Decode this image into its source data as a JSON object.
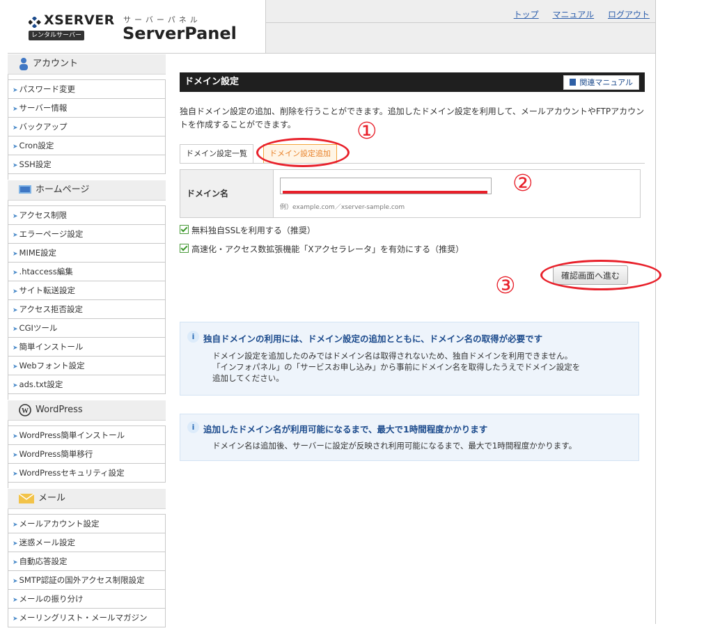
{
  "header": {
    "brand": "XSERVER",
    "badge": "レンタルサーバー",
    "panel_sub": "サーバーパネル",
    "panel_title": "ServerPanel",
    "links": [
      "トップ",
      "マニュアル",
      "ログアウト"
    ]
  },
  "sidebar": {
    "sections": [
      {
        "title": "アカウント",
        "icon": "person-icon",
        "items": [
          "パスワード変更",
          "サーバー情報",
          "バックアップ",
          "Cron設定",
          "SSH設定"
        ]
      },
      {
        "title": "ホームページ",
        "icon": "monitor-icon",
        "items": [
          "アクセス制限",
          "エラーページ設定",
          "MIME設定",
          ".htaccess編集",
          "サイト転送設定",
          "アクセス拒否設定",
          "CGIツール",
          "簡単インストール",
          "Webフォント設定",
          "ads.txt設定"
        ]
      },
      {
        "title": "WordPress",
        "icon": "wordpress-icon",
        "items": [
          "WordPress簡単インストール",
          "WordPress簡単移行",
          "WordPressセキュリティ設定"
        ]
      },
      {
        "title": "メール",
        "icon": "envelope-icon",
        "items": [
          "メールアカウント設定",
          "迷惑メール設定",
          "自動応答設定",
          "SMTP認証の国外アクセス制限設定",
          "メールの振り分け",
          "メーリングリスト・メールマガジン"
        ]
      }
    ]
  },
  "main": {
    "title": "ドメイン設定",
    "manual_button": "関連マニュアル",
    "description": "独自ドメイン設定の追加、削除を行うことができます。追加したドメイン設定を利用して、メールアカウントやFTPアカウントを作成することができます。",
    "tabs": [
      "ドメイン設定一覧",
      "ドメイン設定追加"
    ],
    "form": {
      "label": "ドメイン名",
      "value": "",
      "example": "例）example.com／xserver-sample.com"
    },
    "checkboxes": [
      {
        "label": "無料独自SSLを利用する（推奨）",
        "checked": true
      },
      {
        "label": "高速化・アクセス数拡張機能「Xアクセラレータ」を有効にする（推奨）",
        "checked": true
      }
    ],
    "confirm_button": "確認画面へ進む",
    "info1": {
      "title": "独自ドメインの利用には、ドメイン設定の追加とともに、ドメイン名の取得が必要です",
      "lines": [
        "ドメイン設定を追加したのみではドメイン名は取得されないため、独自ドメインを利用できません。",
        "「インフォパネル」の「サービスお申し込み」から事前にドメイン名を取得したうえでドメイン設定を",
        "追加してください。"
      ]
    },
    "info2": {
      "title": "追加したドメイン名が利用可能になるまで、最大で1時間程度かかります",
      "lines": [
        "ドメイン名は追加後、サーバーに設定が反映され利用可能になるまで、最大で1時間程度かかります。"
      ]
    }
  },
  "annotations": [
    "①",
    "②",
    "③"
  ],
  "colors": {
    "annotation_red": "#e8202a",
    "titlebar": "#1f1f1f",
    "link": "#2a5cab"
  }
}
